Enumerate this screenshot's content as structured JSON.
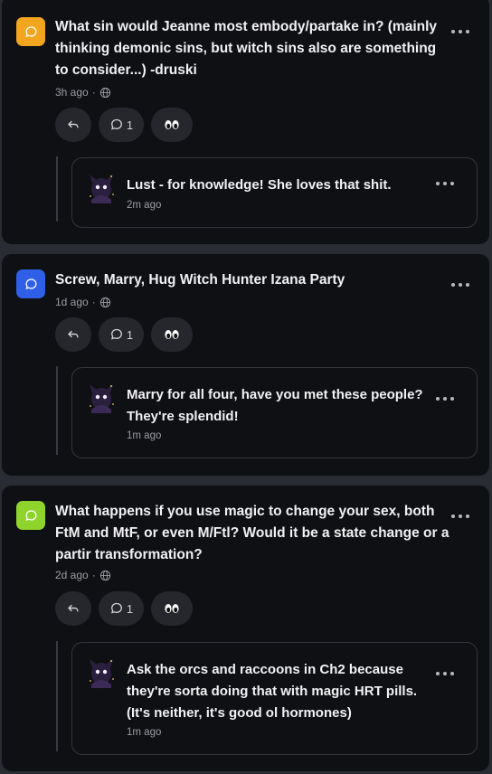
{
  "posts": [
    {
      "question": "What sin would Jeanne most embody/partake in? (mainly thinking demonic sins, but witch sins also are something to consider...) -druski",
      "time": "3h ago",
      "icon_color": "#f2a51e",
      "comment_count": "1",
      "reply": {
        "text": "Lust - for knowledge! She loves that shit.",
        "time": "2m ago"
      }
    },
    {
      "question": "Screw, Marry, Hug Witch Hunter Izana Party",
      "time": "1d ago",
      "icon_color": "#2f5fe6",
      "comment_count": "1",
      "reply": {
        "text": "Marry for all four, have you met these people? They're splendid!",
        "time": "1m ago"
      }
    },
    {
      "question": "What happens if you use magic to change your sex, both FtM and MtF, or even M/Ftl? Would it be a state change or a partir transformation?",
      "time": "2d ago",
      "icon_color": "#8fd42d",
      "comment_count": "1",
      "reply": {
        "text": "Ask the orcs and raccoons in Ch2 because they're sorta doing that with magic HRT pills. (It's neither, it's good ol hormones)",
        "time": "1m ago"
      }
    }
  ],
  "icons": {
    "question": "speech-bubble-icon",
    "visibility": "globe-icon",
    "reply": "reply-arrow-icon",
    "comment": "comment-icon",
    "reaction": "eyes-icon",
    "menu": "more-dots-icon"
  }
}
